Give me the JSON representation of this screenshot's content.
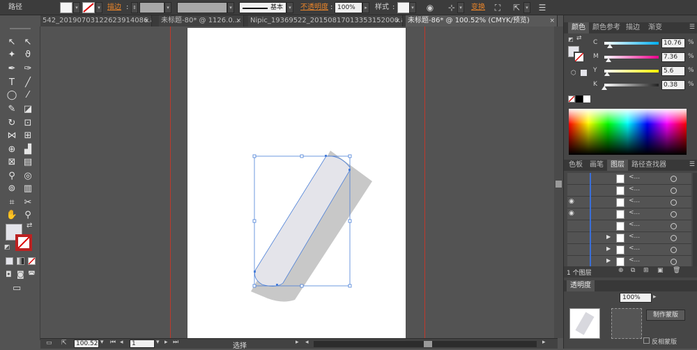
{
  "control_bar": {
    "selection_label": "路径",
    "stroke_label": "描边",
    "stroke_profile": "基本",
    "opacity_label": "不透明度",
    "opacity_value": "100%",
    "style_label": "样式",
    "transform_label": "变换"
  },
  "tabs": [
    {
      "label": "542_20190703122623914086.ai*",
      "active": false
    },
    {
      "label": "未标题-80* @ 1126.0...",
      "active": false
    },
    {
      "label": "Nipic_19369522_20150817013353152000.ai*",
      "active": false
    },
    {
      "label": "未标题-86* @ 100.52% (CMYK/预览)",
      "active": true
    }
  ],
  "tab_close_glyph": "×",
  "tools": [
    {
      "icon": "selection-icon",
      "glyph": "↖"
    },
    {
      "icon": "direct-selection-icon",
      "glyph": "↖"
    },
    {
      "icon": "magic-wand-icon",
      "glyph": "✦"
    },
    {
      "icon": "lasso-icon",
      "glyph": "ϑ"
    },
    {
      "icon": "pen-icon",
      "glyph": "✒"
    },
    {
      "icon": "curvature-icon",
      "glyph": "✑"
    },
    {
      "icon": "type-icon",
      "glyph": "T"
    },
    {
      "icon": "line-icon",
      "glyph": "╱"
    },
    {
      "icon": "ellipse-icon",
      "glyph": "◯"
    },
    {
      "icon": "paintbrush-icon",
      "glyph": "⁄"
    },
    {
      "icon": "pencil-icon",
      "glyph": "✎"
    },
    {
      "icon": "eraser-icon",
      "glyph": "◪"
    },
    {
      "icon": "rotate-icon",
      "glyph": "↻"
    },
    {
      "icon": "scale-icon",
      "glyph": "⊡"
    },
    {
      "icon": "width-icon",
      "glyph": "⋈"
    },
    {
      "icon": "free-transform-icon",
      "glyph": "⊞"
    },
    {
      "icon": "shape-builder-icon",
      "glyph": "⊕"
    },
    {
      "icon": "chart-icon",
      "glyph": "▟"
    },
    {
      "icon": "mesh-icon",
      "glyph": "⊠"
    },
    {
      "icon": "gradient-icon",
      "glyph": "▤"
    },
    {
      "icon": "eyedropper-icon",
      "glyph": "⚲"
    },
    {
      "icon": "blend-icon",
      "glyph": "◎"
    },
    {
      "icon": "symbol-sprayer-icon",
      "glyph": "⊚"
    },
    {
      "icon": "column-graph-icon",
      "glyph": "▥"
    },
    {
      "icon": "artboard-icon",
      "glyph": "⌗"
    },
    {
      "icon": "slice-icon",
      "glyph": "✂"
    },
    {
      "icon": "hand-icon",
      "glyph": "✋"
    },
    {
      "icon": "zoom-icon",
      "glyph": "⚲"
    }
  ],
  "status_bar": {
    "zoom": "100.52",
    "artboard_number": "1",
    "tool_name": "选择"
  },
  "color_panel": {
    "tabs": [
      {
        "label": "颜色",
        "active": true
      },
      {
        "label": "颜色参考",
        "active": false
      },
      {
        "label": "描边",
        "active": false
      },
      {
        "label": "渐变",
        "active": false
      }
    ],
    "channels": [
      {
        "label": "C",
        "value": "10.76",
        "fraction": 0.1076,
        "color": "#00aeef"
      },
      {
        "label": "M",
        "value": "7.36",
        "fraction": 0.0736,
        "color": "#ec008c"
      },
      {
        "label": "Y",
        "value": "5.6",
        "fraction": 0.056,
        "color": "#fff200"
      },
      {
        "label": "K",
        "value": "0.38",
        "fraction": 0.0038,
        "color": "#222222"
      }
    ],
    "unit": "%"
  },
  "layers_panel": {
    "tabs": [
      {
        "label": "色板",
        "active": false
      },
      {
        "label": "画笔",
        "active": false
      },
      {
        "label": "图层",
        "active": true
      },
      {
        "label": "路径查找器",
        "active": false
      }
    ],
    "rows": [
      {
        "name": "<...",
        "eye": false,
        "expandable": false
      },
      {
        "name": "<...",
        "eye": false,
        "expandable": false
      },
      {
        "name": "<...",
        "eye": true,
        "expandable": false
      },
      {
        "name": "<...",
        "eye": true,
        "expandable": false
      },
      {
        "name": "<...",
        "eye": false,
        "expandable": false
      },
      {
        "name": "<...",
        "eye": false,
        "expandable": true
      },
      {
        "name": "<...",
        "eye": false,
        "expandable": true
      },
      {
        "name": "<...",
        "eye": false,
        "expandable": true
      }
    ],
    "footer_text": "1 个图层"
  },
  "transparency_panel": {
    "tab_label": "透明度",
    "opacity_value": "100%",
    "make_mask_label": "制作蒙版",
    "invert_mask_label": "反相蒙版"
  },
  "colors": {
    "guide": "#c0392b",
    "shape_fill": "#e4e4ea",
    "shape_shadow": "#c8c8c8",
    "selection": "#4a7fd8"
  }
}
